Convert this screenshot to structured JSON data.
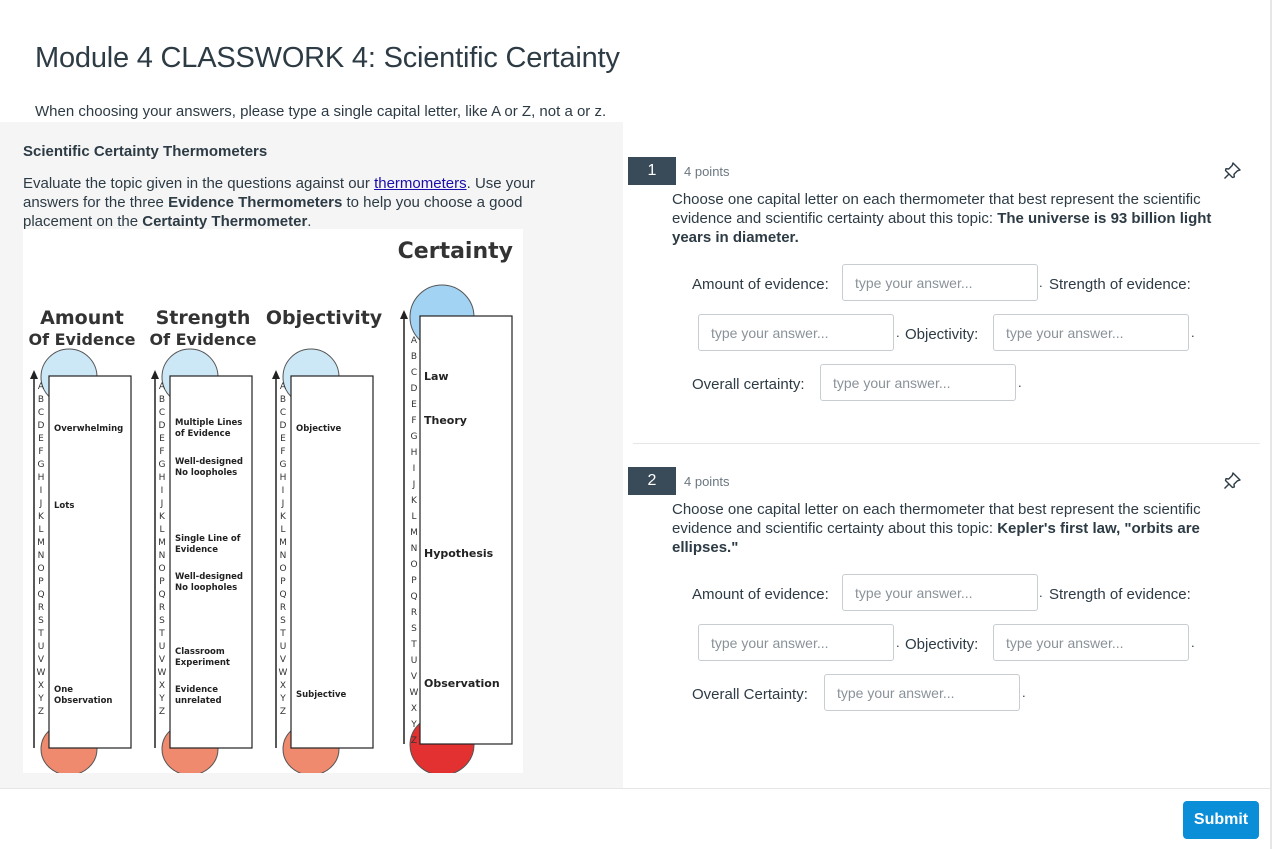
{
  "page": {
    "title": "Module 4 CLASSWORK 4: Scientific Certainty",
    "instructions": "When choosing your answers, please type a single capital letter, like A or Z, not a or z."
  },
  "stimulus": {
    "title": "Scientific Certainty Thermometers",
    "intro_before_link": "Evaluate the topic given in the questions against our ",
    "link_text": "thermometers",
    "intro_mid1": ". Use your answers for the three ",
    "bold1": "Evidence Thermometers",
    "intro_mid2": " to help you choose a good placement on the ",
    "bold2": "Certainty Thermometer",
    "intro_end": "."
  },
  "figure": {
    "certainty_heading": "Certainty",
    "amount_heading_1": "Amount",
    "amount_heading_2": "Of Evidence",
    "strength_heading_1": "Strength",
    "strength_heading_2": "Of Evidence",
    "objectivity_heading": "Objectivity",
    "letters": [
      "A",
      "B",
      "C",
      "D",
      "E",
      "F",
      "G",
      "H",
      "I",
      "J",
      "K",
      "L",
      "M",
      "N",
      "O",
      "P",
      "Q",
      "R",
      "S",
      "T",
      "U",
      "V",
      "W",
      "X",
      "Y",
      "Z"
    ],
    "amount_labels": [
      "Overwhelming",
      "Lots",
      "One",
      "Observation"
    ],
    "strength_labels": [
      "Multiple Lines",
      "of Evidence",
      "Well-designed",
      "No loopholes",
      "Single Line of",
      "Evidence",
      "Well-designed",
      "No loopholes",
      "Classroom",
      "Experiment",
      "Evidence",
      "unrelated"
    ],
    "objectivity_labels": [
      "Objective",
      "Subjective"
    ],
    "certainty_labels": [
      "Law",
      "Theory",
      "Hypothesis",
      "Observation"
    ],
    "colors": {
      "bulb_top": "#cce7f5",
      "bulb_bottom": "#ef8a6e",
      "cert_top": "#a3d3f2",
      "cert_bottom": "#e33030"
    }
  },
  "questions": [
    {
      "number": "1",
      "points": "4 points",
      "text_prefix": "Choose one capital letter on each thermometer that best represent the scientific evidence and scientific certainty about this topic: ",
      "topic": "The universe is 93 billion light years in diameter.",
      "label_amount": "Amount of evidence:",
      "label_strength": "Strength of evidence:",
      "label_objectivity": "Objectivity:",
      "label_overall": "Overall certainty:",
      "placeholder": "type your answer..."
    },
    {
      "number": "2",
      "points": "4 points",
      "text_prefix": "Choose one capital letter on each thermometer that best represent the scientific evidence and scientific certainty about this topic: ",
      "topic": "Kepler's first law, \"orbits are ellipses.\"",
      "label_amount": "Amount of evidence:",
      "label_strength": "Strength of evidence:",
      "label_objectivity": "Objectivity:",
      "label_overall": "Overall Certainty:",
      "placeholder": "type your answer..."
    }
  ],
  "footer": {
    "submit_label": "Submit",
    "submit_color": "#0b8ed8"
  },
  "icons": {
    "question_pin": "pin-icon"
  }
}
